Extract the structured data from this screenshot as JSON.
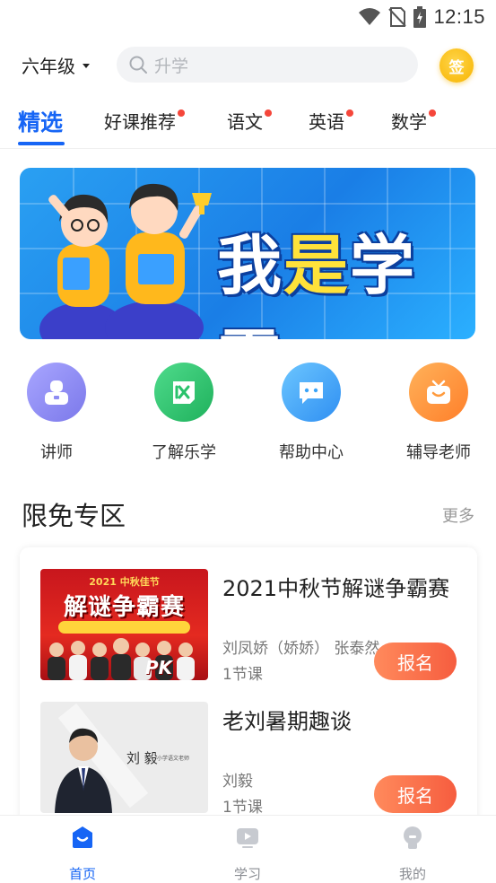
{
  "status_bar": {
    "time": "12:15"
  },
  "header": {
    "grade": "六年级",
    "search_placeholder": "升学",
    "sign_label": "签"
  },
  "tabs": [
    {
      "label": "精选",
      "active": true,
      "dot": false
    },
    {
      "label": "好课推荐",
      "active": false,
      "dot": true
    },
    {
      "label": "语文",
      "active": false,
      "dot": true
    },
    {
      "label": "英语",
      "active": false,
      "dot": true
    },
    {
      "label": "数学",
      "active": false,
      "dot": true
    }
  ],
  "banner": {
    "title_part1": "我",
    "title_highlight": "是",
    "title_part2": "学霸"
  },
  "quick_entries": [
    {
      "label": "讲师",
      "icon": "lecturer-icon",
      "color": "#8d8cf3"
    },
    {
      "label": "了解乐学",
      "icon": "lexue-icon",
      "color": "#29c26b"
    },
    {
      "label": "帮助中心",
      "icon": "chat-help-icon",
      "color": "#3ba4f8"
    },
    {
      "label": "辅导老师",
      "icon": "tv-tutor-icon",
      "color": "#ff9a3c"
    }
  ],
  "section": {
    "title": "限免专区",
    "more": "更多"
  },
  "courses": [
    {
      "title": "2021中秋节解谜争霸赛",
      "teachers": "刘凤娇（娇娇） 张泰然",
      "lessons": "1节课",
      "button": "报名",
      "thumb_top": "2021 中秋佳节",
      "thumb_main": "解谜争霸赛",
      "thumb_badge": "PK"
    },
    {
      "title": "老刘暑期趣谈",
      "teachers": "刘毅",
      "lessons": "1节课",
      "button": "报名",
      "thumb_name": "刘 毅",
      "thumb_role": "小学语文老师"
    }
  ],
  "bottom_nav": [
    {
      "label": "首页",
      "active": true,
      "icon": "home-icon"
    },
    {
      "label": "学习",
      "active": false,
      "icon": "play-icon"
    },
    {
      "label": "我的",
      "active": false,
      "icon": "profile-icon"
    }
  ],
  "colors": {
    "accent": "#1665f5",
    "signup": "#f65d3f",
    "dot": "#f5463a"
  }
}
